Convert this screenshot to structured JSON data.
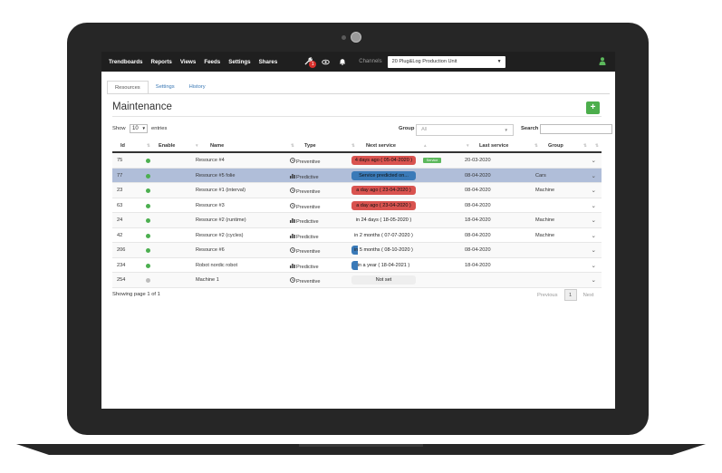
{
  "nav": {
    "items": [
      "Trendboards",
      "Reports",
      "Views",
      "Feeds",
      "Settings",
      "Shares"
    ],
    "notif_count": "1",
    "channels_label": "Channels",
    "channel_selected": "20 Plug&Log Production Unit"
  },
  "tabs": [
    "Resources",
    "Settings",
    "History"
  ],
  "page": {
    "title": "Maintenance",
    "add_label": "+",
    "show_label": "Show",
    "show_value": "10",
    "entries_label": "entries",
    "group_label": "Group",
    "group_placeholder": "All",
    "search_label": "Search",
    "showing_text": "Showing page 1 of 1",
    "prev_label": "Previous",
    "page_number": "1",
    "next_label": "Next"
  },
  "table": {
    "columns": [
      "Id",
      "Enable",
      "Name",
      "Type",
      "Next service",
      "Last service",
      "Group"
    ],
    "rows": [
      {
        "id": "75",
        "enabled": true,
        "name": "Resource #4",
        "type": "Preventive",
        "next": "4 days ago ( 05-04-2020 )",
        "next_style": "red",
        "badge": "Service",
        "last": "20-03-2020",
        "group": ""
      },
      {
        "id": "77",
        "enabled": true,
        "name": "Resource #5 folie",
        "type": "Predictive",
        "next": "Service predicted on...",
        "next_style": "blue",
        "badge": "",
        "last": "08-04-2020",
        "group": "Cars"
      },
      {
        "id": "23",
        "enabled": true,
        "name": "Resource #1 (interval)",
        "type": "Preventive",
        "next": "a day ago ( 23-04-2020 )",
        "next_style": "red",
        "badge": "",
        "last": "08-04-2020",
        "group": "Machine"
      },
      {
        "id": "63",
        "enabled": true,
        "name": "Resource #3",
        "type": "Preventive",
        "next": "a day ago ( 23-04-2020 )",
        "next_style": "red",
        "badge": "",
        "last": "08-04-2020",
        "group": ""
      },
      {
        "id": "24",
        "enabled": true,
        "name": "Resource #2 (runtime)",
        "type": "Predictive",
        "next": "in 24 days ( 18-05-2020 )",
        "next_style": "plain",
        "badge": "",
        "last": "18-04-2020",
        "group": "Machine"
      },
      {
        "id": "42",
        "enabled": true,
        "name": "Resource #2 (cycles)",
        "type": "Predictive",
        "next": "in 2 months ( 07-07-2020 )",
        "next_style": "plain",
        "badge": "",
        "last": "08-04-2020",
        "group": "Machine"
      },
      {
        "id": "206",
        "enabled": true,
        "name": "Resource #6",
        "type": "Preventive",
        "next": "in 5 months ( 08-10-2020 )",
        "next_style": "partial",
        "badge": "",
        "last": "08-04-2020",
        "group": ""
      },
      {
        "id": "234",
        "enabled": true,
        "name": "Robot nordic robot",
        "type": "Predictive",
        "next": "in a year ( 18-04-2021 )",
        "next_style": "partial",
        "badge": "",
        "last": "18-04-2020",
        "group": ""
      },
      {
        "id": "254",
        "enabled": false,
        "name": "Machine 1",
        "type": "Preventive",
        "next": "Not set",
        "next_style": "grey",
        "badge": "",
        "last": "",
        "group": ""
      }
    ]
  },
  "colors": {
    "navbar": "#1f1f1f",
    "accent_green": "#4cae4c",
    "overdue_red": "#d9534f",
    "predicted_blue": "#3a7ab8",
    "selected_row": "#b0bed9"
  },
  "icons": {
    "tool": "wrench-icon",
    "eye": "eye-icon",
    "bell": "bell-icon",
    "user": "user-icon",
    "preventive": "clock-icon",
    "predictive": "bar-chart-icon",
    "expand": "chevron-down-icon"
  }
}
